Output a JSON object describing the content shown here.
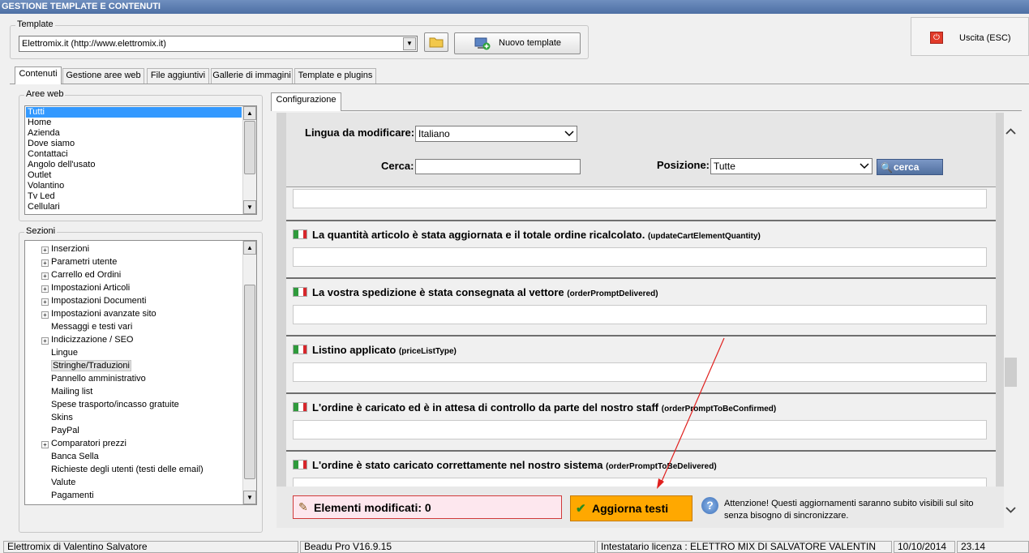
{
  "window": {
    "title": "GESTIONE TEMPLATE E CONTENUTI"
  },
  "template": {
    "group_label": "Template",
    "selected": "Elettromix.it (http://www.elettromix.it)",
    "new_button": "Nuovo template"
  },
  "exit_button": "Uscita (ESC)",
  "tabs": [
    {
      "label": "Contenuti"
    },
    {
      "label": "Gestione aree web"
    },
    {
      "label": "File aggiuntivi"
    },
    {
      "label": "Gallerie di immagini"
    },
    {
      "label": "Template e plugins"
    }
  ],
  "aree_web": {
    "label": "Aree web",
    "items": [
      "Tutti",
      "Home",
      "Azienda",
      "Dove siamo",
      "Contattaci",
      "Angolo dell'usato",
      "Outlet",
      "Volantino",
      "Tv Led",
      "Cellulari"
    ],
    "selected_index": 0
  },
  "sezioni": {
    "label": "Sezioni",
    "items": [
      {
        "label": "Inserzioni",
        "expandable": true
      },
      {
        "label": "Parametri utente",
        "expandable": true
      },
      {
        "label": "Carrello ed Ordini",
        "expandable": true
      },
      {
        "label": "Impostazioni Articoli",
        "expandable": true
      },
      {
        "label": "Impostazioni Documenti",
        "expandable": true
      },
      {
        "label": "Impostazioni avanzate sito",
        "expandable": true
      },
      {
        "label": "Messaggi e testi vari",
        "expandable": false
      },
      {
        "label": "Indicizzazione / SEO",
        "expandable": true
      },
      {
        "label": "Lingue",
        "expandable": false
      },
      {
        "label": "Stringhe/Traduzioni",
        "expandable": false,
        "selected": true
      },
      {
        "label": "Pannello amministrativo",
        "expandable": false
      },
      {
        "label": "Mailing list",
        "expandable": false
      },
      {
        "label": "Spese trasporto/incasso gratuite",
        "expandable": false
      },
      {
        "label": "Skins",
        "expandable": false
      },
      {
        "label": "PayPal",
        "expandable": false
      },
      {
        "label": "Comparatori prezzi",
        "expandable": true
      },
      {
        "label": "Banca Sella",
        "expandable": false
      },
      {
        "label": "Richieste degli utenti (testi delle email)",
        "expandable": false
      },
      {
        "label": "Valute",
        "expandable": false
      },
      {
        "label": "Pagamenti",
        "expandable": false
      }
    ]
  },
  "config": {
    "tab": "Configurazione",
    "lingua_label": "Lingua da modificare:",
    "lingua_value": "Italiano",
    "cerca_label": "Cerca:",
    "cerca_value": "",
    "posizione_label": "Posizione:",
    "posizione_value": "Tutte",
    "cerca_button": "cerca"
  },
  "entries": [
    {
      "text": "La quantità articolo è stata aggiornata e il totale ordine ricalcolato.",
      "code": "(updateCartElementQuantity)",
      "value": ""
    },
    {
      "text": "La vostra spedizione è stata consegnata al vettore",
      "code": "(orderPromptDelivered)",
      "value": ""
    },
    {
      "text": "Listino applicato",
      "code": "(priceListType)",
      "value": ""
    },
    {
      "text": "L'ordine è caricato ed è in attesa di controllo da parte del nostro staff",
      "code": "(orderPromptToBeConfirmed)",
      "value": ""
    },
    {
      "text": "L'ordine è stato caricato correttamente nel nostro sistema",
      "code": "(orderPromptToBeDelivered)",
      "value": ""
    }
  ],
  "bottom": {
    "modified_label": "Elementi modificati: 0",
    "update_button": "Aggiorna testi",
    "notice_line1": "Attenzione! Questi aggiornamenti saranno subito visibili sul sito",
    "notice_line2": "senza bisogno di sincronizzare."
  },
  "statusbar": {
    "company": "Elettromix di Valentino Salvatore",
    "version": "Beadu Pro V16.9.15",
    "license": "Intestatario licenza : ELETTRO MIX DI SALVATORE VALENTIN",
    "date": "10/10/2014",
    "time": "23.14"
  },
  "colors": {
    "accent_orange": "#ffa800",
    "modified_bg": "#fde7ee",
    "annotation_arrow": "#e0201e"
  }
}
